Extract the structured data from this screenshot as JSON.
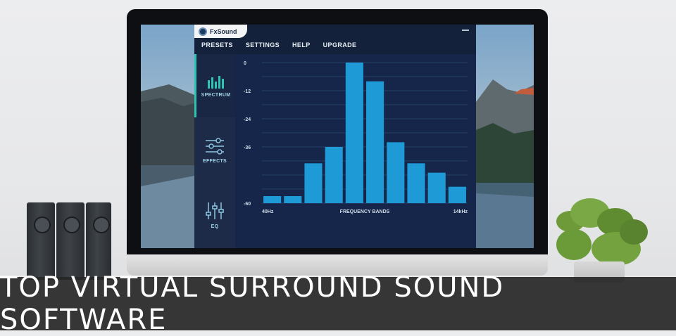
{
  "app": {
    "name": "FxSound",
    "menu": [
      "PRESETS",
      "SETTINGS",
      "HELP",
      "UPGRADE"
    ],
    "sidebar": [
      {
        "label": "SPECTRUM",
        "icon": "spectrum-icon",
        "active": true
      },
      {
        "label": "EFFECTS",
        "icon": "sliders-icon",
        "active": false
      },
      {
        "label": "EQ",
        "icon": "eq-icon",
        "active": false
      }
    ],
    "accent_color": "#2fc4b2"
  },
  "chart_data": {
    "type": "bar",
    "title": "",
    "xlabel": "FREQUENCY BANDS",
    "x_start_label": "40Hz",
    "x_end_label": "14kHz",
    "ylim": [
      -60,
      0
    ],
    "y_ticks": [
      "0",
      "-12",
      "-24",
      "-36",
      "-60"
    ],
    "y_tick_values": [
      0,
      -12,
      -24,
      -36,
      -60
    ],
    "values": [
      -57,
      -57,
      -43,
      -36,
      0,
      -8,
      -34,
      -43,
      -47,
      -53
    ],
    "bar_color": "#1e9ad6"
  },
  "caption": "TOP VIRTUAL SURROUND SOUND SOFTWARE"
}
